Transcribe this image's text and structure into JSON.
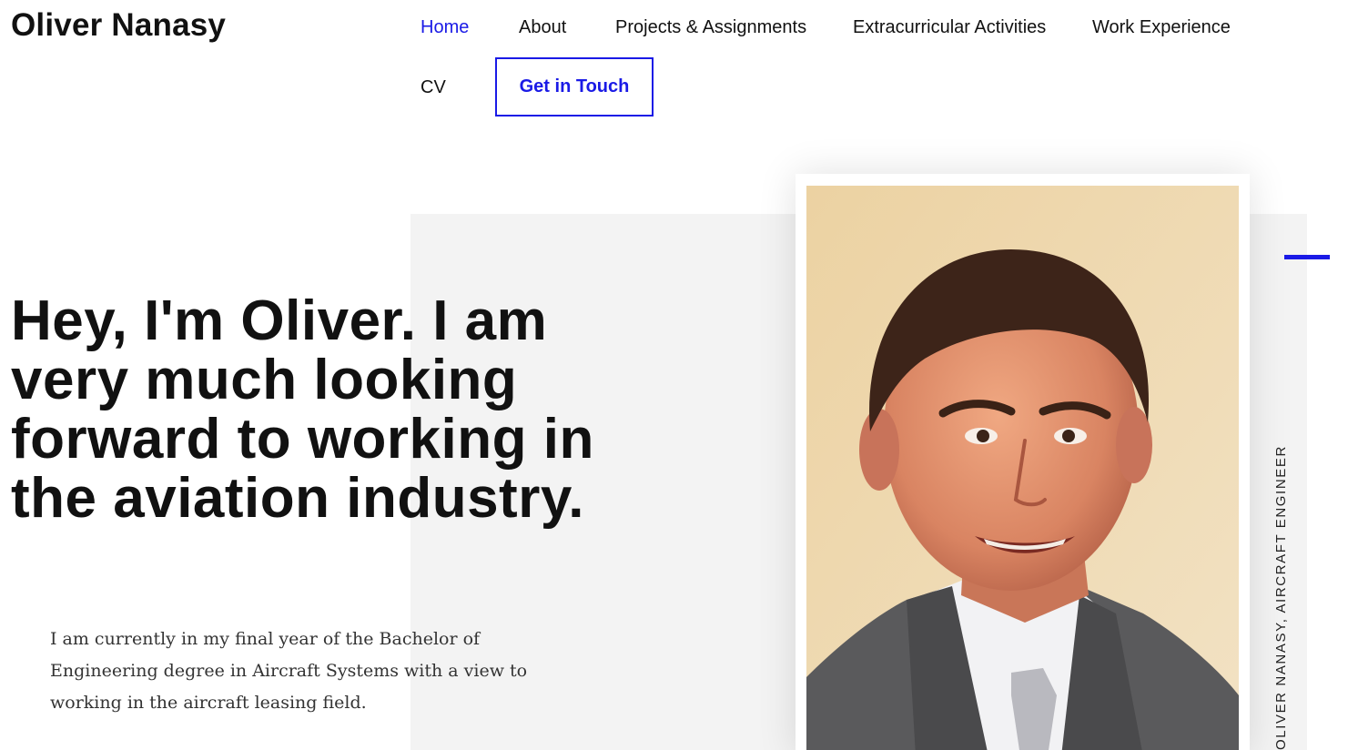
{
  "header": {
    "site_title": "Oliver Nanasy",
    "nav": [
      {
        "label": "Home",
        "active": true
      },
      {
        "label": "About"
      },
      {
        "label": "Projects & Assignments"
      },
      {
        "label": "Extracurricular Activities"
      },
      {
        "label": "Work Experience"
      },
      {
        "label": "CV"
      }
    ],
    "cta_label": "Get in Touch"
  },
  "hero": {
    "headline": "Hey, I'm Oliver. I am very much looking forward to working in the aviation industry.",
    "intro": "I am currently in my final year of the Bachelor of Engineering degree in Aircraft Systems with a view to working in the aircraft leasing field.",
    "vertical_caption": "OLIVER NANASY, AIRCRAFT ENGINEER"
  },
  "colors": {
    "accent": "#1a1ae6",
    "panel": "#f3f3f3",
    "text": "#111111"
  }
}
